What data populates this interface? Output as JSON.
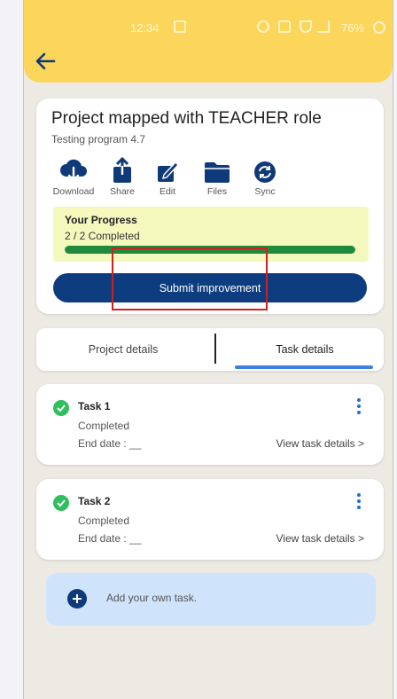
{
  "status_bar": {
    "time": "12:34",
    "battery": "76%"
  },
  "project": {
    "title": "Project mapped with TEACHER role",
    "subtitle": "Testing program 4.7"
  },
  "actions": [
    {
      "label": "Download",
      "icon": "cloud-download-icon"
    },
    {
      "label": "Share",
      "icon": "share-icon"
    },
    {
      "label": "Edit",
      "icon": "edit-icon"
    },
    {
      "label": "Files",
      "icon": "folder-icon"
    },
    {
      "label": "Sync",
      "icon": "sync-icon"
    }
  ],
  "progress": {
    "title": "Your Progress",
    "text": "2 / 2 Completed",
    "fraction": 1.0
  },
  "submit_button": "Submit improvement",
  "tabs": [
    {
      "label": "Project details"
    },
    {
      "label": "Task details"
    }
  ],
  "tasks": [
    {
      "name": "Task 1",
      "status": "Completed",
      "end_date": "End date : __",
      "view": "View task details >"
    },
    {
      "name": "Task 2",
      "status": "Completed",
      "end_date": "End date : __",
      "view": "View task details >"
    }
  ],
  "add_task": "Add your own task.",
  "colors": {
    "header": "#fbd65a",
    "primary_button": "#0d3d7e",
    "progress_fill": "#1f8a3c",
    "progress_bg": "#f4f8bd",
    "check": "#2fbf5f",
    "tab_underline": "#3c7fe0",
    "add_card": "#cfe3fb",
    "highlight": "#d01f1f"
  }
}
